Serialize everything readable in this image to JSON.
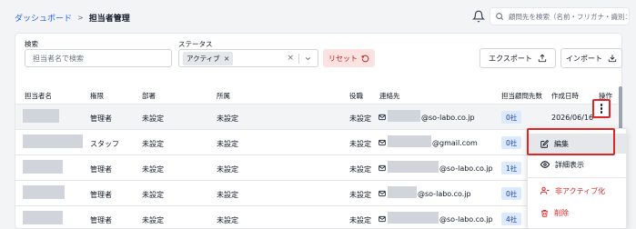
{
  "breadcrumb": {
    "parent": "ダッシュボード",
    "separator": ">",
    "current": "担当者管理"
  },
  "top_search": {
    "placeholder": "顧問先を検索（名前・フリガナ・識別コード"
  },
  "filters": {
    "keyword_label": "検索",
    "keyword_placeholder": "担当者名で検索",
    "status_label": "ステータス",
    "status_chip": "アクティブ",
    "chip_remove": "×",
    "clear": "×",
    "reset_label": "リセット",
    "export_label": "エクスポート",
    "import_label": "インポート"
  },
  "table": {
    "headers": {
      "name": "担当者名",
      "role": "権限",
      "department": "部署",
      "affiliation": "所属",
      "position": "役職",
      "contact": "連絡先",
      "clients": "担当顧問先数",
      "created": "作成日時",
      "actions": "操作"
    },
    "rows": [
      {
        "role": "管理者",
        "department": "未設定",
        "affiliation": "未設定",
        "position": "未設定",
        "email_domain": "@so-labo.co.jp",
        "clients": "0社",
        "created": "2026/06/16"
      },
      {
        "role": "スタッフ",
        "department": "未設定",
        "affiliation": "未設定",
        "position": "未設定",
        "email_domain": "@gmail.com",
        "clients": "0社",
        "created": ""
      },
      {
        "role": "管理者",
        "department": "未設定",
        "affiliation": "未設定",
        "position": "未設定",
        "email_domain": "@so-labo.co.jp",
        "clients": "1社",
        "created": ""
      },
      {
        "role": "管理者",
        "department": "未設定",
        "affiliation": "未設定",
        "position": "未設定",
        "email_domain": "@so-labo.co.jp",
        "clients": "0社",
        "created": ""
      },
      {
        "role": "管理者",
        "department": "未設定",
        "affiliation": "未設定",
        "position": "未設定",
        "email_domain": "@so-labo.co.jp",
        "clients": "4社",
        "created": ""
      }
    ]
  },
  "menu": {
    "edit": "編集",
    "details": "詳細表示",
    "deactivate": "非アクティブ化",
    "delete": "削除"
  },
  "colors": {
    "accent": "#2563eb",
    "danger": "#dc2626",
    "badge_bg": "#dbeafe",
    "reset_bg": "#fde2e2"
  }
}
